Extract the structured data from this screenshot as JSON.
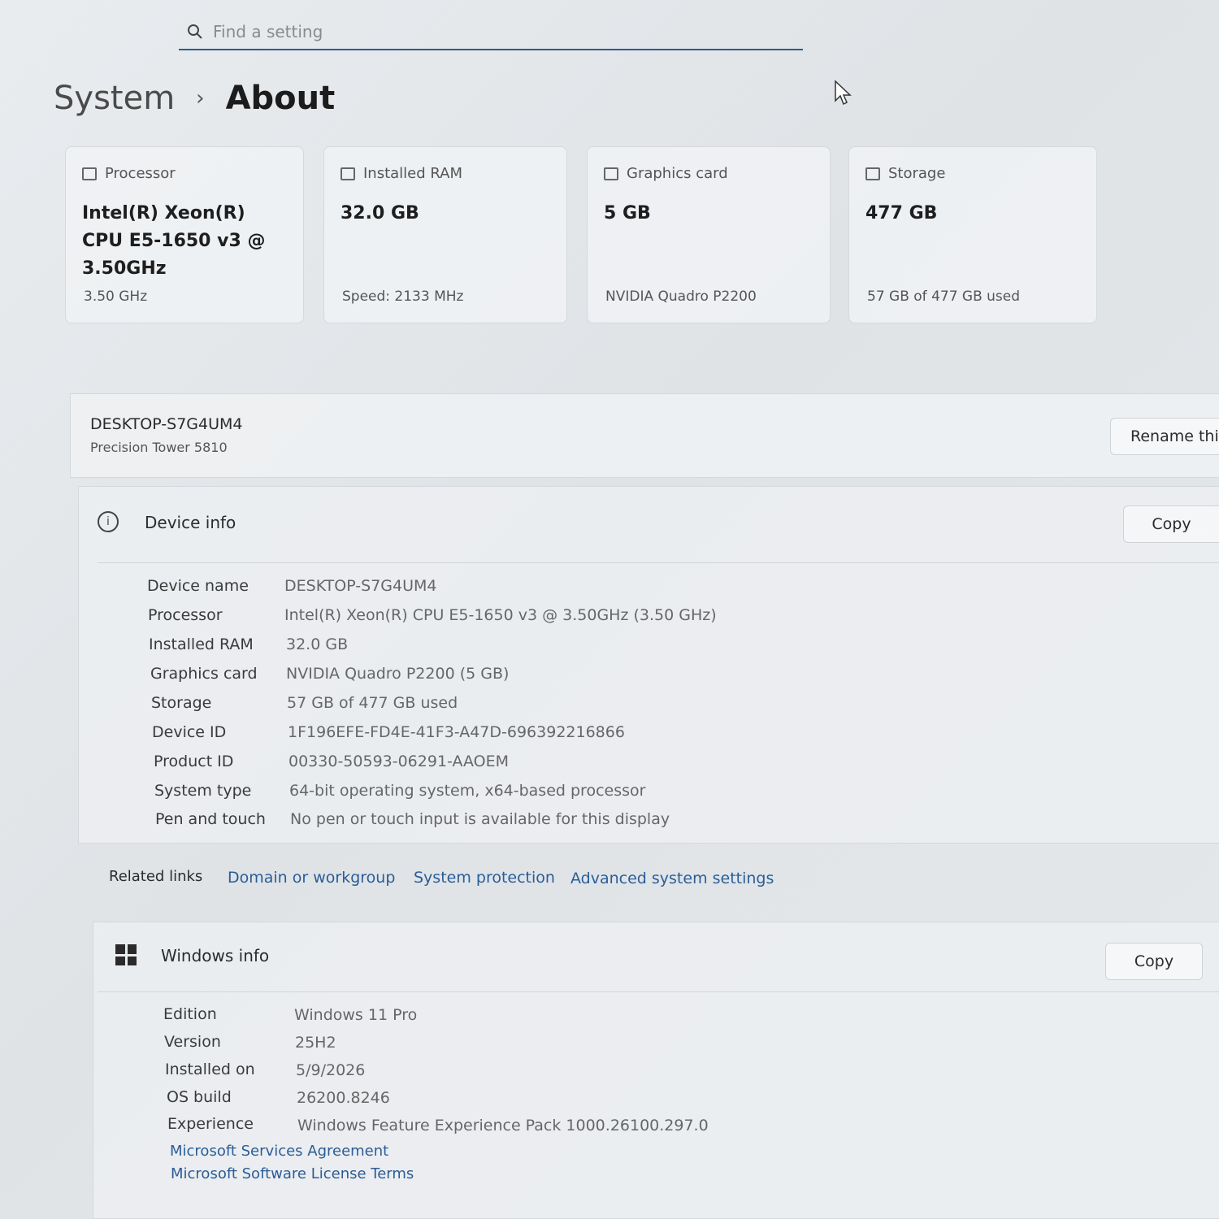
{
  "search": {
    "placeholder": "Find a setting"
  },
  "breadcrumb": {
    "parent": "System",
    "separator": "›",
    "current": "About"
  },
  "cards": [
    {
      "label": "Processor",
      "value": "Intel(R) Xeon(R) CPU E5-1650 v3 @ 3.50GHz",
      "sub": "3.50 GHz"
    },
    {
      "label": "Installed RAM",
      "value": "32.0 GB",
      "sub": "Speed: 2133 MHz"
    },
    {
      "label": "Graphics card",
      "value": "5 GB",
      "sub": "NVIDIA Quadro P2200"
    },
    {
      "label": "Storage",
      "value": "477 GB",
      "sub": "57 GB of 477 GB used"
    }
  ],
  "device": {
    "name": "DESKTOP-S7G4UM4",
    "model": "Precision Tower 5810",
    "rename_label": "Rename this PC"
  },
  "device_info": {
    "title": "Device info",
    "copy_label": "Copy",
    "rows": [
      {
        "label": "Device name",
        "value": "DESKTOP-S7G4UM4"
      },
      {
        "label": "Processor",
        "value": "Intel(R) Xeon(R) CPU E5-1650 v3 @ 3.50GHz (3.50 GHz)"
      },
      {
        "label": "Installed RAM",
        "value": "32.0 GB"
      },
      {
        "label": "Graphics card",
        "value": "NVIDIA Quadro P2200 (5 GB)"
      },
      {
        "label": "Storage",
        "value": "57 GB of 477 GB used"
      },
      {
        "label": "Device ID",
        "value": "1F196EFE-FD4E-41F3-A47D-696392216866"
      },
      {
        "label": "Product ID",
        "value": "00330-50593-06291-AAOEM"
      },
      {
        "label": "System type",
        "value": "64-bit operating system, x64-based processor"
      },
      {
        "label": "Pen and touch",
        "value": "No pen or touch input is available for this display"
      }
    ]
  },
  "related_links": {
    "label": "Related links",
    "links": [
      "Domain or workgroup",
      "System protection",
      "Advanced system settings"
    ]
  },
  "windows_info": {
    "title": "Windows info",
    "copy_label": "Copy",
    "rows": [
      {
        "label": "Edition",
        "value": "Windows 11 Pro"
      },
      {
        "label": "Version",
        "value": "25H2"
      },
      {
        "label": "Installed on",
        "value": "5/9/2026"
      },
      {
        "label": "OS build",
        "value": "26200.8246"
      },
      {
        "label": "Experience",
        "value": "Windows Feature Experience Pack 1000.26100.297.0"
      }
    ],
    "links": [
      "Microsoft Services Agreement",
      "Microsoft Software License Terms"
    ]
  }
}
